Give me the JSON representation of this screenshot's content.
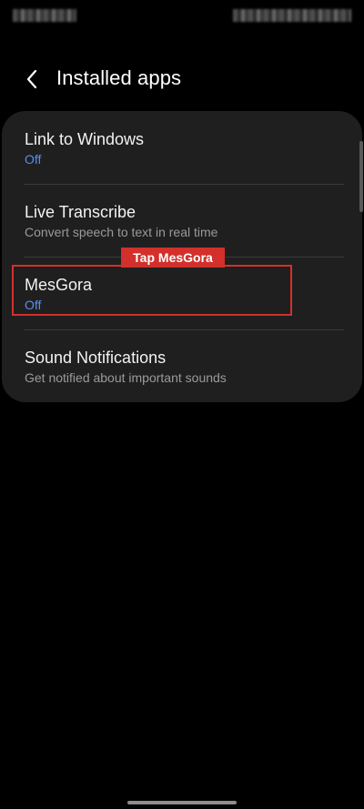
{
  "header": {
    "title": "Installed apps"
  },
  "items": [
    {
      "title": "Link to Windows",
      "subtitle": "Off",
      "subtitle_style": "blue"
    },
    {
      "title": "Live Transcribe",
      "subtitle": "Convert speech to text in real time",
      "subtitle_style": "gray"
    },
    {
      "title": "MesGora",
      "subtitle": "Off",
      "subtitle_style": "blue"
    },
    {
      "title": "Sound Notifications",
      "subtitle": "Get notified about important sounds",
      "subtitle_style": "gray"
    }
  ],
  "annotation": {
    "label": "Tap MesGora",
    "color": "#d3302b"
  },
  "colors": {
    "background": "#000000",
    "card": "#1f1f1f",
    "accent_blue": "#5b8def",
    "subtext_gray": "#9a9a9a"
  },
  "icons": {
    "back": "chevron-left-icon"
  }
}
